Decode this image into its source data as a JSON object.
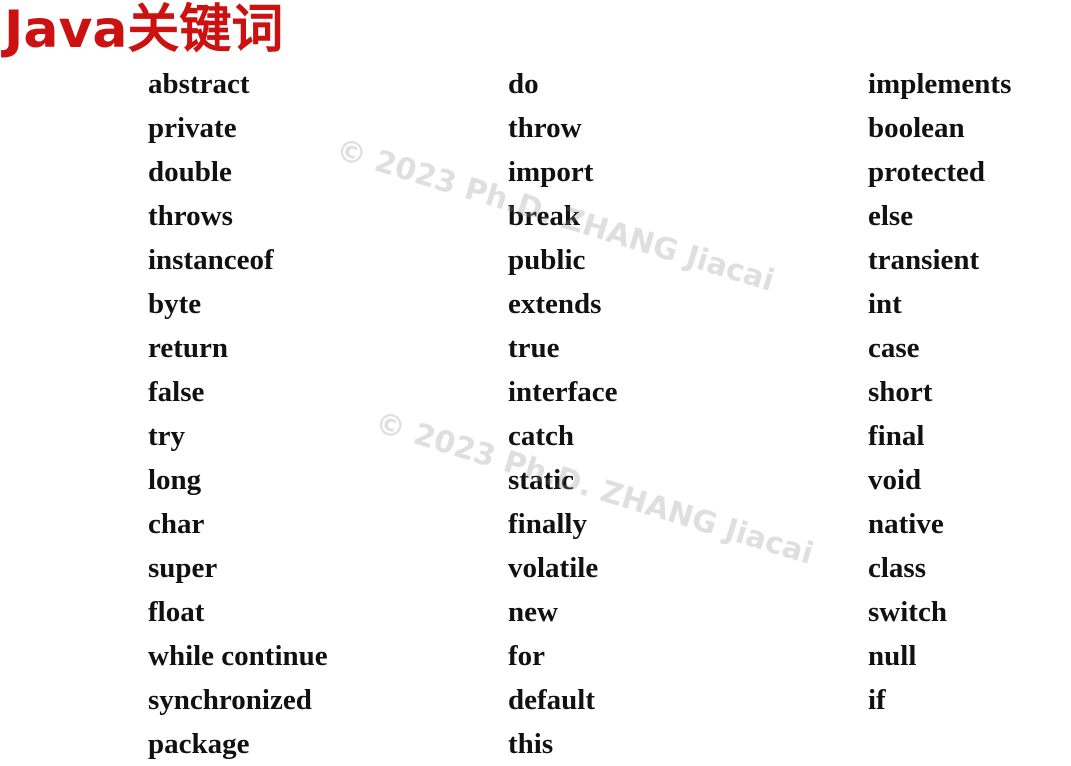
{
  "slide": {
    "title": "Java关键词",
    "watermark": "© 2023 Ph.D. ZHANG Jiacai"
  },
  "keywords": {
    "column1": [
      "abstract",
      "private",
      "double",
      "throws",
      "instanceof",
      "byte",
      "return",
      "false",
      "try",
      "long",
      "char",
      "super",
      "float",
      "while continue",
      "synchronized",
      "package"
    ],
    "column2": [
      "do",
      "throw",
      "import",
      "break",
      "public",
      "extends",
      "true",
      "interface",
      "catch",
      "static",
      "finally",
      "volatile",
      "new",
      "for",
      "default",
      "this"
    ],
    "column3": [
      "implements",
      "boolean",
      "protected",
      "else",
      "transient",
      "int",
      "case",
      "short",
      "final",
      "void",
      "native",
      "class",
      "switch",
      "null",
      "if"
    ]
  },
  "colors": {
    "title": "#cc1111",
    "text": "#111111",
    "background": "#ffffff"
  }
}
